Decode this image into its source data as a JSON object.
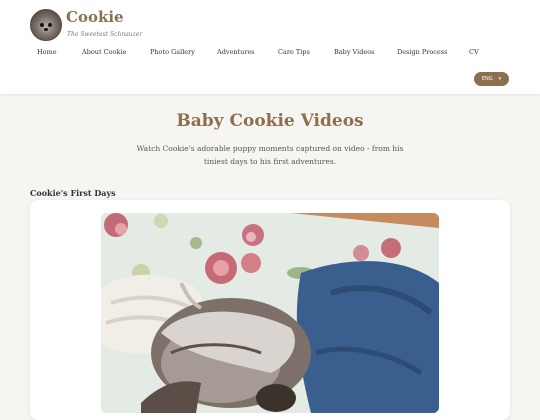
{
  "brand": {
    "name": "Cookie",
    "tagline": "The Sweetest Schnauzer"
  },
  "nav": {
    "items": [
      "Home",
      "About Cookie",
      "Photo Gallery",
      "Adventures",
      "Care Tips",
      "Baby Videos",
      "Design Process",
      "CV"
    ]
  },
  "language": {
    "selected": "ENG",
    "chevron_icon": "chevron-down-icon"
  },
  "main": {
    "title": "Baby Cookie Videos",
    "intro": "Watch Cookie's adorable puppy moments captured on video - from his tiniest days to his first adventures.",
    "section_title": "Cookie's First Days"
  },
  "colors": {
    "accent": "#8b6f4e",
    "background": "#f7f5f2",
    "card": "#ffffff"
  }
}
